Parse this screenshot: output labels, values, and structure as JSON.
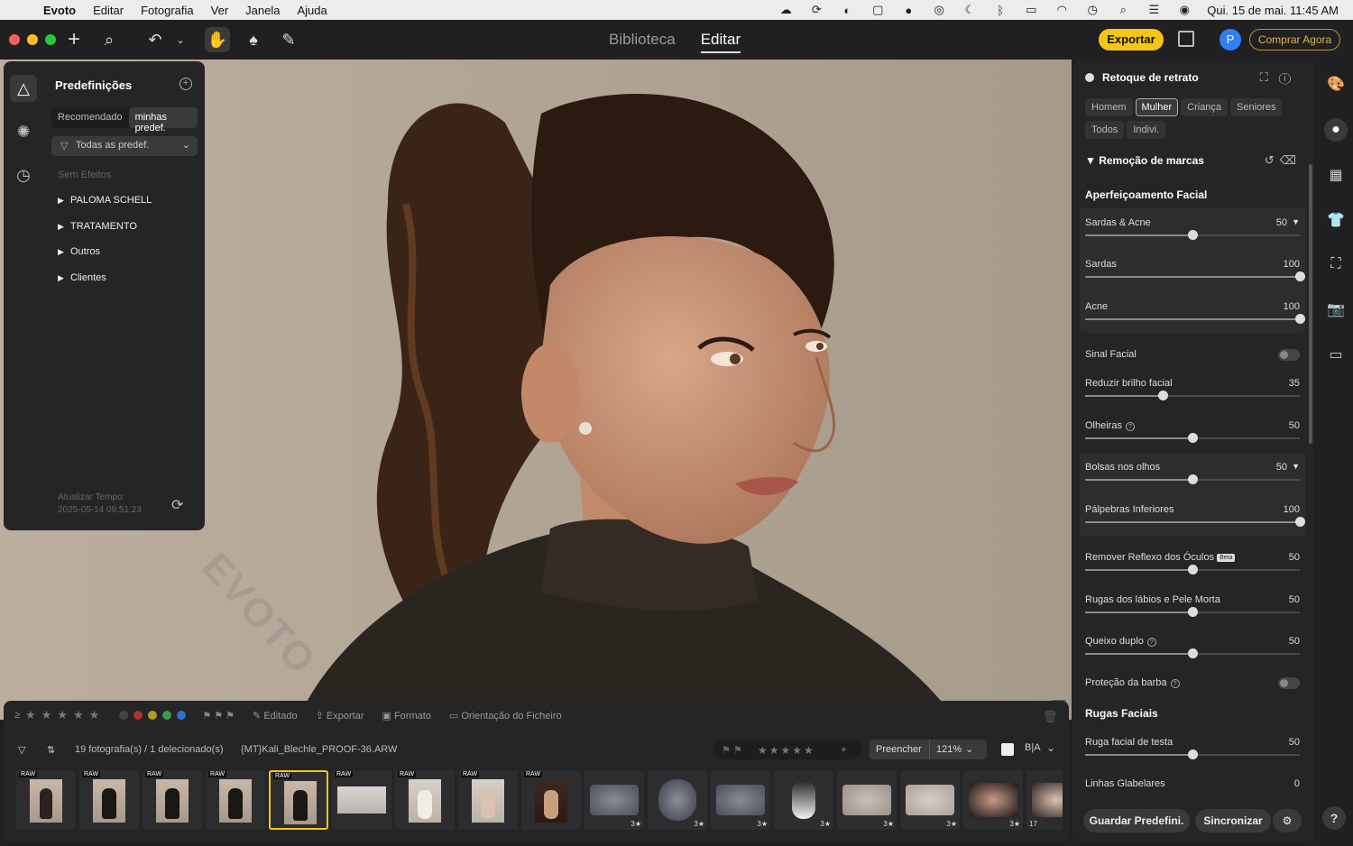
{
  "menubar": {
    "app": "Evoto",
    "items": [
      "Editar",
      "Fotografia",
      "Ver",
      "Janela",
      "Ajuda"
    ],
    "clock": "Qui. 15 de mai.  11:45 AM"
  },
  "toolbar": {
    "modes": [
      "Biblioteca",
      "Editar"
    ],
    "active_mode": "Editar",
    "export_label": "Exportar",
    "buy_label": "Comprar Agora",
    "avatar_initial": "P"
  },
  "left_panel": {
    "title": "Predefinições",
    "tabs": [
      "Recomendado",
      "minhas predef."
    ],
    "active_tab": "minhas predef.",
    "filter_label": "Todas as predef.",
    "no_effects": "Sem Efeitos",
    "folders": [
      "PALOMA SCHELL",
      "TRATAMENTO",
      "Outros",
      "Clientes"
    ],
    "update_label": "Atualizar Tempo:",
    "update_time": "2025-05-14 09:51:23"
  },
  "canvas": {
    "watermark": "EVOTO"
  },
  "right_panel": {
    "title": "Retoque de retrato",
    "chips": [
      "Homem",
      "Mulher",
      "Criança",
      "Seniores",
      "Todos",
      "Indivi."
    ],
    "active_chip": "Mulher",
    "section": "Remoção de marcas",
    "subsection": "Aperfeiçoamento Facial",
    "sliders": {
      "sardas_acne": {
        "label": "Sardas & Acne",
        "value": "50"
      },
      "sardas": {
        "label": "Sardas",
        "value": "100"
      },
      "acne": {
        "label": "Acne",
        "value": "100"
      },
      "sinal": {
        "label": "Sinal Facial"
      },
      "brilho": {
        "label": "Reduzir brilho facial",
        "value": "35"
      },
      "olheiras": {
        "label": "Olheiras",
        "value": "50"
      },
      "bolsas": {
        "label": "Bolsas nos olhos",
        "value": "50"
      },
      "palpebras": {
        "label": "Pálpebras Inferiores",
        "value": "100"
      },
      "reflexo": {
        "label": "Remover Reflexo dos Óculos",
        "badge": "Beta",
        "value": "50"
      },
      "rugas_labios": {
        "label": "Rugas dos lábios e Pele Morta",
        "value": "50"
      },
      "queixo": {
        "label": "Queixo duplo",
        "value": "50"
      },
      "barba": {
        "label": "Proteção da barba"
      },
      "testa": {
        "label": "Ruga facial de testa",
        "value": "50"
      },
      "glabelares": {
        "label": "Linhas Glabelares",
        "value": "0"
      }
    },
    "section2": "Rugas Faciais",
    "save_preset": "Guardar Predefini.",
    "sync": "Sincronizar"
  },
  "filmstrip": {
    "filters": [
      "Editado",
      "Exportar",
      "Formato",
      "Orientação do Ficheiro"
    ],
    "count_text": "19 fotografia(s) / 1 delecionado(s)",
    "filename": "{MT}Kali_Blechle_PROOF-36.ARW",
    "fill_label": "Preencher",
    "zoom": "121%",
    "raw_tag": "RAW",
    "rating": "3★",
    "last_count": "17"
  }
}
